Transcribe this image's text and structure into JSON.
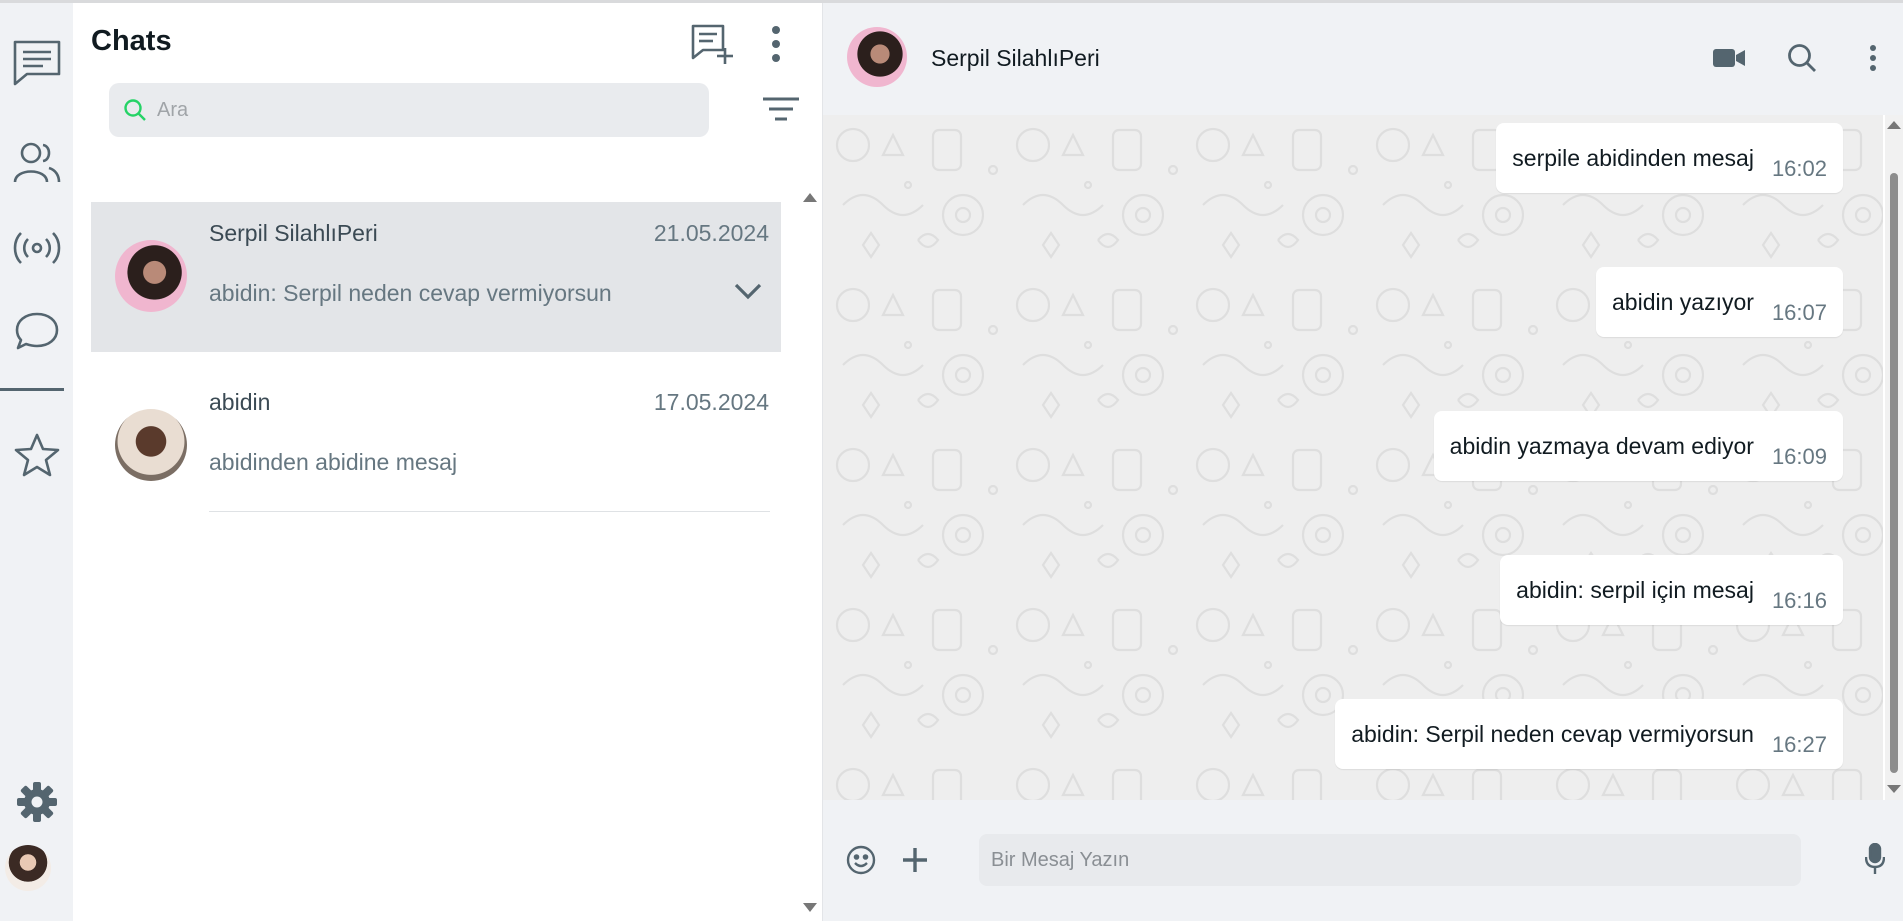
{
  "sidebar_rail": {
    "items": [
      {
        "name": "chats",
        "icon": "chat-list-icon"
      },
      {
        "name": "contacts",
        "icon": "people-icon"
      },
      {
        "name": "channels",
        "icon": "broadcast-icon"
      },
      {
        "name": "communities",
        "icon": "speech-bubble-icon"
      },
      {
        "name": "starred",
        "icon": "star-icon"
      }
    ],
    "bottom": [
      {
        "name": "settings",
        "icon": "gear-icon"
      },
      {
        "name": "profile",
        "icon": "profile-avatar"
      }
    ]
  },
  "chat_list": {
    "title": "Chats",
    "search": {
      "placeholder": "Ara",
      "value": ""
    },
    "chats": [
      {
        "name": "Serpil SilahlıPeri",
        "date": "21.05.2024",
        "preview": "abidin: Serpil neden cevap vermiyorsun",
        "active": true
      },
      {
        "name": "abidin",
        "date": "17.05.2024",
        "preview": "abidinden abidine mesaj",
        "active": false
      }
    ]
  },
  "conversation": {
    "contact_name": "Serpil SilahlıPeri",
    "messages": [
      {
        "text": "serpile abidinden mesaj",
        "time": "16:02"
      },
      {
        "text": "abidin yazıyor",
        "time": "16:07"
      },
      {
        "text": "abidin yazmaya devam ediyor",
        "time": "16:09"
      },
      {
        "text": "abidin: serpil için mesaj",
        "time": "16:16"
      },
      {
        "text": "abidin: Serpil neden cevap vermiyorsun",
        "time": "16:27"
      }
    ],
    "composer": {
      "placeholder": "Bir Mesaj Yazın",
      "value": ""
    }
  },
  "colors": {
    "accent": "#25d366",
    "icon": "#54656f",
    "panel": "#f0f2f5",
    "active_row": "#e3e5e8"
  }
}
